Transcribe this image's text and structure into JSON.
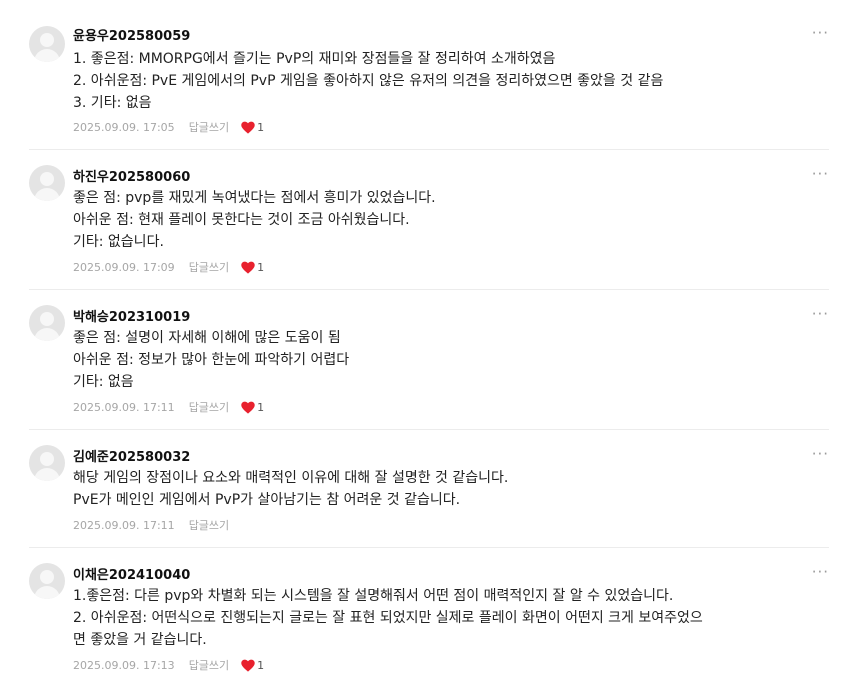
{
  "comments": [
    {
      "author": "윤용우202580059",
      "lines": [
        "1. 좋은점: MMORPG에서 즐기는 PvP의 재미와 장점들을 잘 정리하여 소개하였음",
        "2. 아쉬운점: PvE 게임에서의 PvP 게임을 좋아하지 않은 유저의 의견을 정리하였으면 좋았을 것 같음",
        "3. 기타: 없음"
      ],
      "date": "2025.09.09. 17:05",
      "reply_label": "답글쓰기",
      "likes": "1"
    },
    {
      "author": "하진우202580060",
      "lines": [
        "좋은 점: pvp를 재밌게 녹여냈다는 점에서 흥미가 있었습니다.",
        "아쉬운 점: 현재 플레이 못한다는 것이 조금 아쉬웠습니다.",
        "기타: 없습니다."
      ],
      "date": "2025.09.09. 17:09",
      "reply_label": "답글쓰기",
      "likes": "1"
    },
    {
      "author": "박해승202310019",
      "lines": [
        "좋은 점: 설명이 자세해 이해에 많은 도움이 됨",
        "아쉬운 점: 정보가 많아 한눈에 파악하기 어렵다",
        "기타: 없음"
      ],
      "date": "2025.09.09. 17:11",
      "reply_label": "답글쓰기",
      "likes": "1"
    },
    {
      "author": "김예준202580032",
      "lines": [
        "해당 게임의 장점이나 요소와 매력적인 이유에 대해 잘 설명한 것 같습니다.",
        "PvE가 메인인 게임에서 PvP가 살아남기는 참 어려운 것 같습니다."
      ],
      "date": "2025.09.09. 17:11",
      "reply_label": "답글쓰기",
      "likes": ""
    },
    {
      "author": "이채은202410040",
      "lines": [
        "1.좋은점: 다른 pvp와 차별화 되는 시스템을 잘 설명해줘서 어떤 점이 매력적인지 잘 알 수 있었습니다.",
        "2. 아쉬운점: 어떤식으로 진행되는지 글로는 잘 표현 되었지만 실제로 플레이 화면이 어떤지 크게 보여주었으",
        "면 좋았을 거 같습니다."
      ],
      "date": "2025.09.09. 17:13",
      "reply_label": "답글쓰기",
      "likes": "1"
    }
  ],
  "more_glyph": "···",
  "colors": {
    "heart": "#e8212e",
    "meta": "#a6a6a6",
    "divider": "#ececec"
  },
  "icons": {
    "avatar": "default-profile-icon",
    "more": "more-options-icon",
    "like": "heart-icon"
  }
}
